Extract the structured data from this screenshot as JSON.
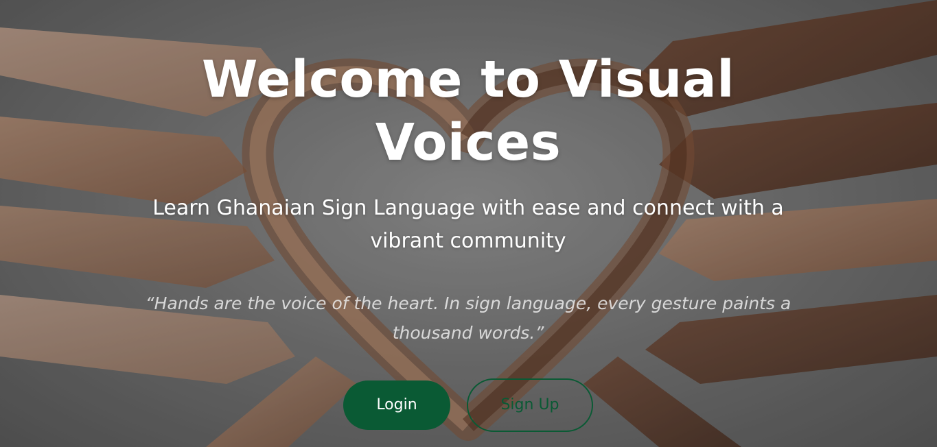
{
  "hero": {
    "title": "Welcome to Visual Voices",
    "subtitle": "Learn Ghanaian Sign Language with ease and connect with a vibrant community",
    "quote": "“Hands are the voice of the heart. In sign language, every gesture paints a thousand words.”",
    "background_image": "hands-forming-heart-image"
  },
  "buttons": {
    "login_label": "Login",
    "signup_label": "Sign Up"
  },
  "colors": {
    "primary": "#0a5a34",
    "text": "#ffffff"
  }
}
